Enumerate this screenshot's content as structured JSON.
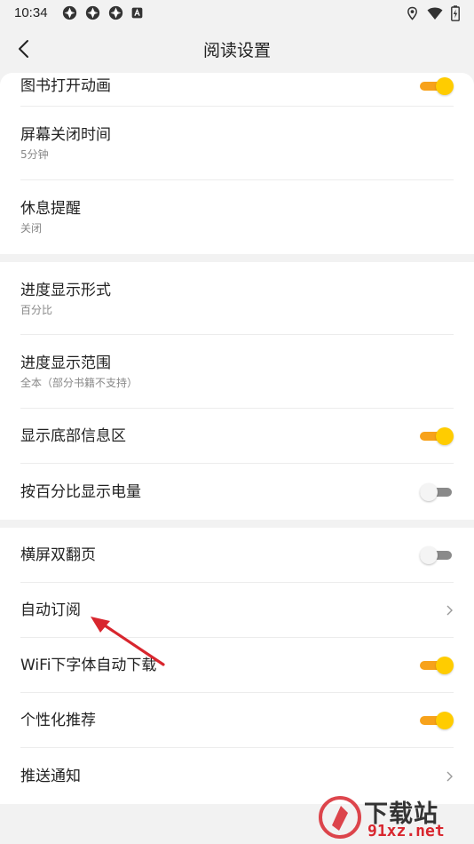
{
  "status_bar": {
    "time": "10:34",
    "notification_icons": [
      "app-notification-icon",
      "app-notification-icon",
      "app-notification-icon",
      "text-a-icon"
    ],
    "right_icons": [
      "location-icon",
      "wifi-icon",
      "battery-charging-icon"
    ]
  },
  "header": {
    "title": "阅读设置",
    "back_icon": "back-arrow-icon"
  },
  "groups": [
    {
      "items": [
        {
          "label": "图书打开动画",
          "control": "toggle",
          "on": true
        },
        {
          "label": "屏幕关闭时间",
          "sub": "5分钟"
        },
        {
          "label": "休息提醒",
          "sub": "关闭"
        }
      ]
    },
    {
      "items": [
        {
          "label": "进度显示形式",
          "sub": "百分比"
        },
        {
          "label": "进度显示范围",
          "sub": "全本（部分书籍不支持）"
        },
        {
          "label": "显示底部信息区",
          "control": "toggle",
          "on": true
        },
        {
          "label": "按百分比显示电量",
          "control": "toggle",
          "on": false
        }
      ]
    },
    {
      "items": [
        {
          "label": "横屏双翻页",
          "control": "toggle",
          "on": false
        },
        {
          "label": "自动订阅",
          "control": "chevron"
        },
        {
          "label": "WiFi下字体自动下载",
          "control": "toggle",
          "on": true
        },
        {
          "label": "个性化推荐",
          "control": "toggle",
          "on": true
        },
        {
          "label": "推送通知",
          "control": "chevron"
        }
      ]
    }
  ],
  "colors": {
    "toggle_on_track": "#f7a21b",
    "toggle_on_knob": "#ffcc00",
    "toggle_off_track": "#8a8a8a",
    "annotation_arrow": "#d8262e"
  },
  "watermark": {
    "title": "下载站",
    "url": "91xz.net"
  }
}
